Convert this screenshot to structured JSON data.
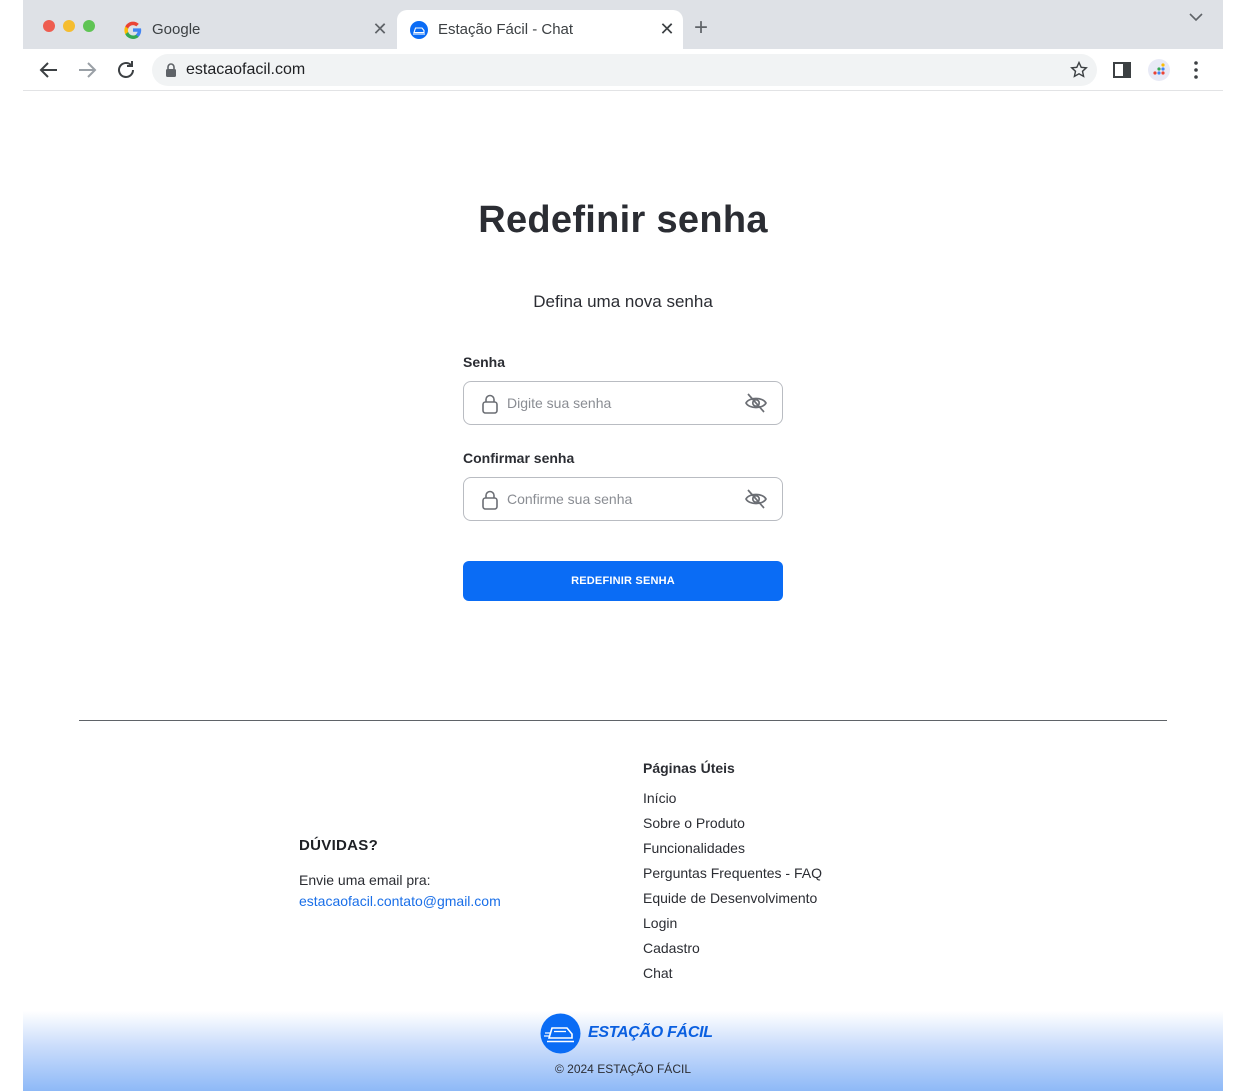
{
  "browser": {
    "tabs": [
      {
        "title": "Google",
        "favicon": "google-g-icon"
      },
      {
        "title": "Estação Fácil - Chat",
        "favicon": "estacao-facil-icon"
      }
    ],
    "close_glyph": "✕",
    "new_tab_glyph": "+",
    "url": "estacaofacil.com"
  },
  "page": {
    "heading": "Redefinir senha",
    "subheading": "Defina uma nova senha",
    "password": {
      "label": "Senha",
      "placeholder": "Digite sua senha"
    },
    "confirm": {
      "label": "Confirmar senha",
      "placeholder": "Confirme sua senha"
    },
    "submit_label": "REDEFINIR SENHA"
  },
  "footer": {
    "duvidas_title": "DÚVIDAS?",
    "duvidas_text": "Envie uma email pra:",
    "duvidas_email": "estacaofacil.contato@gmail.com",
    "links_title": "Páginas Úteis",
    "links": [
      "Início",
      "Sobre o Produto",
      "Funcionalidades",
      "Perguntas Frequentes - FAQ",
      "Equide de Desenvolvimento",
      "Login",
      "Cadastro",
      "Chat"
    ],
    "brand_name": "ESTAÇÃO FÁCIL",
    "copyright": "© 2024 ESTAÇÃO FÁCIL"
  },
  "colors": {
    "primary": "#0a6cf5",
    "link": "#1a6fe8",
    "text": "#2b2d33"
  }
}
